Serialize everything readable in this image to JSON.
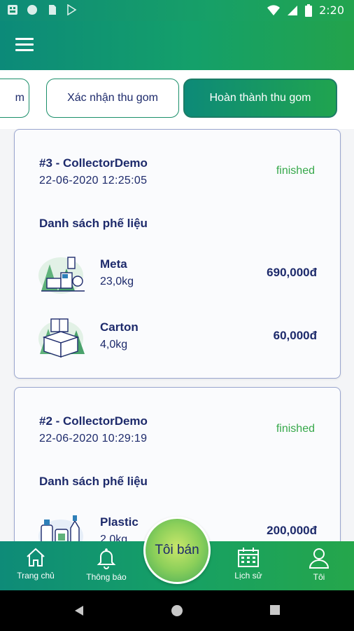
{
  "status_bar": {
    "time": "2:20",
    "icons": [
      "notification-icon",
      "circle-icon",
      "sd-card-icon",
      "play-store-icon",
      "wifi-icon",
      "signal-icon",
      "battery-icon"
    ]
  },
  "app_bar": {
    "menu_icon": "hamburger-menu-icon"
  },
  "tabs": [
    {
      "label": "m",
      "active": false
    },
    {
      "label": "Xác nhận thu gom",
      "active": false
    },
    {
      "label": "Hoàn thành thu gom",
      "active": true
    }
  ],
  "orders": [
    {
      "id": "#3 - CollectorDemo",
      "time": "22-06-2020 12:25:05",
      "status": "finished",
      "list_title": "Danh sách phế liệu",
      "items": [
        {
          "name": "Meta",
          "weight": "23,0kg",
          "price": "690,000đ",
          "icon": "metal-scrap-icon"
        },
        {
          "name": "Carton",
          "weight": "4,0kg",
          "price": "60,000đ",
          "icon": "carton-box-icon"
        }
      ]
    },
    {
      "id": "#2 - CollectorDemo",
      "time": "22-06-2020 10:29:19",
      "status": "finished",
      "list_title": "Danh sách phế liệu",
      "items": [
        {
          "name": "Plastic",
          "weight": "2,0kg",
          "price": "200,000đ",
          "icon": "plastic-bottles-icon"
        }
      ]
    }
  ],
  "bottom_nav": {
    "home": "Trang chủ",
    "notifications": "Thông báo",
    "sell": "Tôi bán",
    "history": "Lịch sử",
    "me": "Tôi"
  },
  "colors": {
    "primary": "#14a06a",
    "accent": "#23a34b",
    "text": "#1d2a6b",
    "status_finished": "#36a84a"
  }
}
